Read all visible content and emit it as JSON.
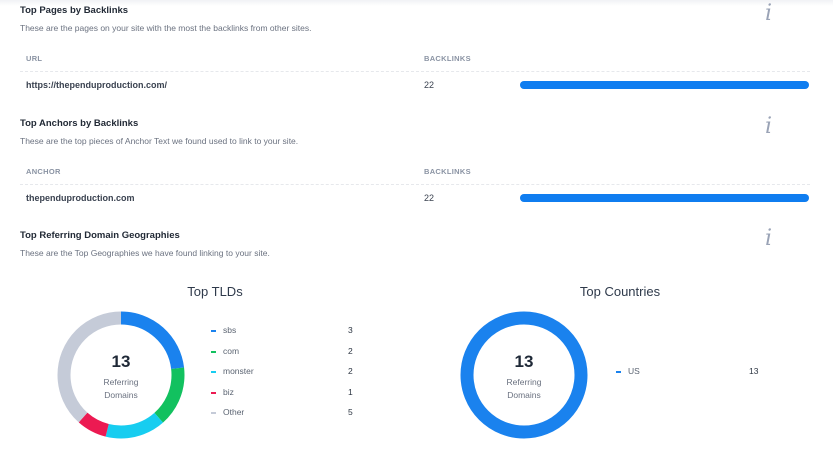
{
  "top_pages": {
    "title": "Top Pages by Backlinks",
    "subtitle": "These are the pages on your site with the most the backlinks from other sites.",
    "col_url": "URL",
    "col_backlinks": "BACKLINKS",
    "rows": [
      {
        "url": "https://thependuproduction.com/",
        "backlinks": "22",
        "share": 1.0
      }
    ]
  },
  "top_anchors": {
    "title": "Top Anchors by Backlinks",
    "subtitle": "These are the top pieces of Anchor Text we found used to link to your site.",
    "col_anchor": "ANCHOR",
    "col_backlinks": "BACKLINKS",
    "rows": [
      {
        "anchor": "thependuproduction.com",
        "backlinks": "22",
        "share": 1.0
      }
    ]
  },
  "geo": {
    "title": "Top Referring Domain Geographies",
    "subtitle": "These are the Top Geographies we have found linking to your site."
  },
  "tlds": {
    "title": "Top TLDs",
    "center_value": "13",
    "center_label_1": "Referring",
    "center_label_2": "Domains",
    "items": [
      {
        "label": "sbs",
        "value": 3,
        "value_text": "3",
        "color": "#1a82ee"
      },
      {
        "label": "com",
        "value": 2,
        "value_text": "2",
        "color": "#12c15f"
      },
      {
        "label": "monster",
        "value": 2,
        "value_text": "2",
        "color": "#17cdf0"
      },
      {
        "label": "biz",
        "value": 1,
        "value_text": "1",
        "color": "#ec1a52"
      },
      {
        "label": "Other",
        "value": 5,
        "value_text": "5",
        "color": "#c5cbd8"
      }
    ]
  },
  "countries": {
    "title": "Top Countries",
    "center_value": "13",
    "center_label_1": "Referring",
    "center_label_2": "Domains",
    "items": [
      {
        "label": "US",
        "value": 13,
        "value_text": "13",
        "color": "#1a82ee"
      }
    ]
  },
  "icons": {
    "info": "i"
  }
}
